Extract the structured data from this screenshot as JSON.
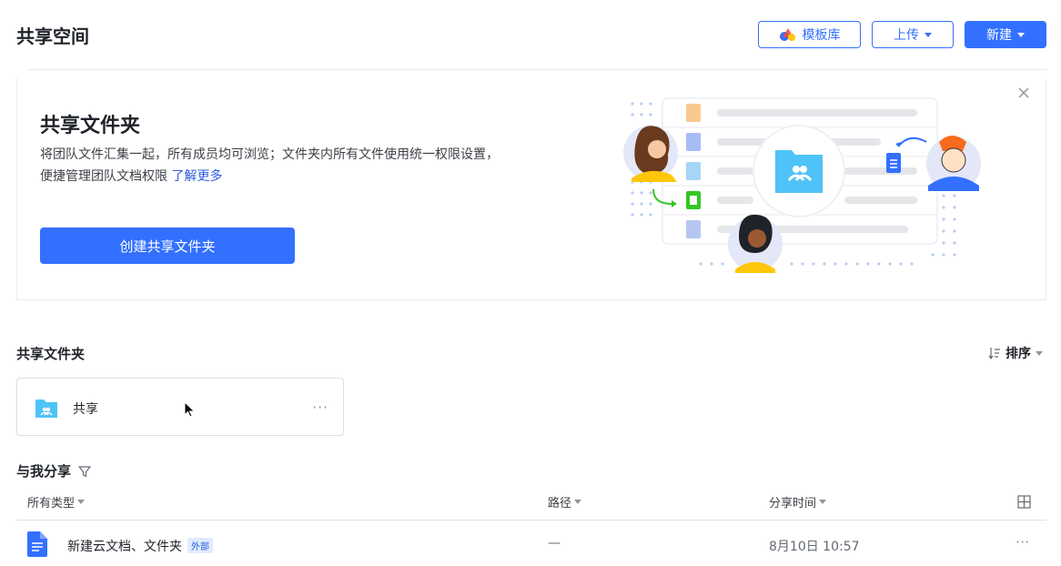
{
  "header": {
    "title": "共享空间",
    "template_label": "模板库",
    "upload_label": "上传",
    "new_label": "新建"
  },
  "banner": {
    "title": "共享文件夹",
    "desc_line1": "将团队文件汇集一起，所有成员均可浏览；文件夹内所有文件使用统一权限设置，",
    "desc_line2": "便捷管理团队文档权限",
    "learn_more": "了解更多",
    "create_button": "创建共享文件夹"
  },
  "shared_folders": {
    "title": "共享文件夹",
    "sort_label": "排序",
    "items": [
      {
        "name": "共享"
      }
    ]
  },
  "shared_with_me": {
    "title": "与我分享",
    "columns": {
      "type": "所有类型",
      "path": "路径",
      "time": "分享时间"
    },
    "rows": [
      {
        "name": "新建云文档、文件夹",
        "badge": "外部",
        "path": "—",
        "time": "8月10日 10:57"
      }
    ]
  },
  "colors": {
    "accent": "#3370ff",
    "folder": "#4fc3f7",
    "doc": "#3370ff"
  }
}
